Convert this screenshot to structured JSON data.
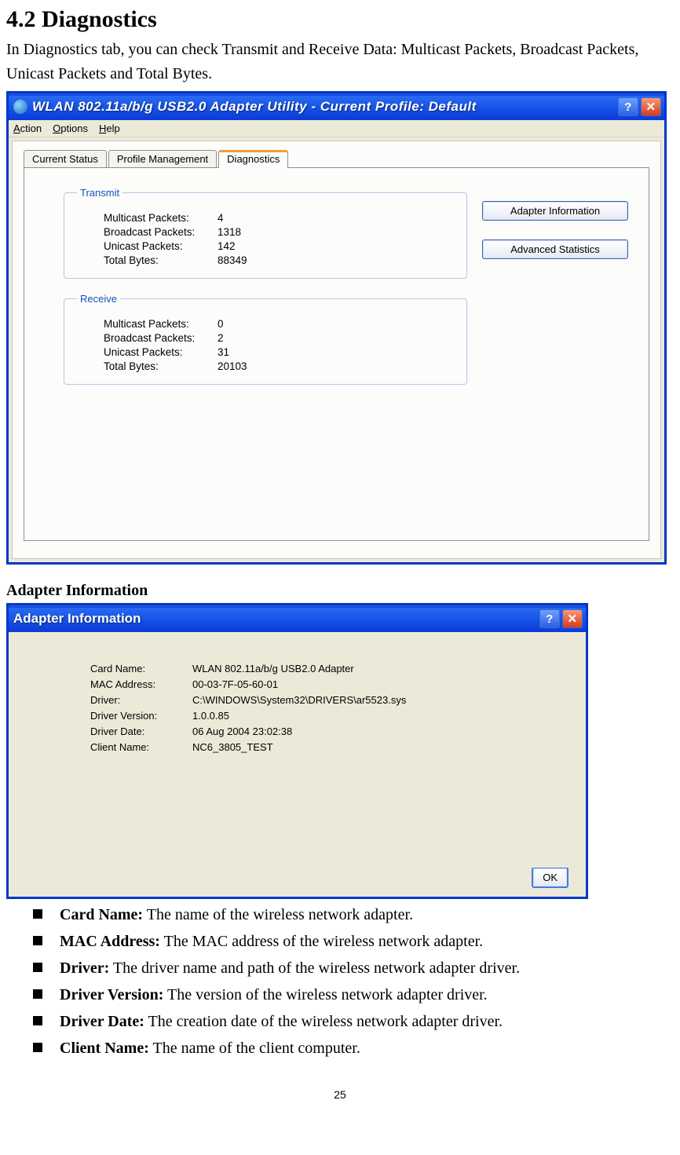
{
  "section": {
    "heading": "4.2 Diagnostics",
    "intro": "In Diagnostics tab, you can check Transmit and Receive Data: Multicast Packets, Broadcast Packets, Unicast Packets and Total Bytes."
  },
  "window1": {
    "title": "WLAN 802.11a/b/g USB2.0 Adapter Utility - Current Profile: Default",
    "menus": {
      "action": "Action",
      "options": "Options",
      "help": "Help"
    },
    "tabs": {
      "status": "Current Status",
      "profile": "Profile Management",
      "diag": "Diagnostics"
    },
    "transmit": {
      "legend": "Transmit",
      "multicast_label": "Multicast Packets:",
      "multicast_value": "4",
      "broadcast_label": "Broadcast Packets:",
      "broadcast_value": "1318",
      "unicast_label": "Unicast Packets:",
      "unicast_value": "142",
      "total_label": "Total Bytes:",
      "total_value": "88349"
    },
    "receive": {
      "legend": "Receive",
      "multicast_label": "Multicast Packets:",
      "multicast_value": "0",
      "broadcast_label": "Broadcast Packets:",
      "broadcast_value": "2",
      "unicast_label": "Unicast Packets:",
      "unicast_value": "31",
      "total_label": "Total Bytes:",
      "total_value": "20103"
    },
    "buttons": {
      "adapter_info": "Adapter Information",
      "adv_stats": "Advanced Statistics"
    }
  },
  "subheading": "Adapter Information",
  "window2": {
    "title": "Adapter Information",
    "fields": {
      "card_label": "Card Name:",
      "card_value": "WLAN 802.11a/b/g USB2.0 Adapter",
      "mac_label": "MAC Address:",
      "mac_value": "00-03-7F-05-60-01",
      "driver_label": "Driver:",
      "driver_value": "C:\\WINDOWS\\System32\\DRIVERS\\ar5523.sys",
      "ver_label": "Driver Version:",
      "ver_value": "1.0.0.85",
      "date_label": "Driver Date:",
      "date_value": "06 Aug 2004 23:02:38",
      "client_label": "Client Name:",
      "client_value": "NC6_3805_TEST"
    },
    "ok": "OK"
  },
  "bullets": {
    "card_name_b": "Card Name:",
    "card_name_t": " The name of the wireless network adapter.",
    "mac_b": "MAC Address:",
    "mac_t": " The MAC address of the wireless network adapter.",
    "driver_b": "Driver:",
    "driver_t": " The driver name and path of the wireless network adapter driver.",
    "ver_b": "Driver Version:",
    "ver_t": " The version of the wireless network adapter driver.",
    "date_b": "Driver Date:",
    "date_t": " The creation date of the wireless network adapter driver.",
    "client_b": "Client Name:",
    "client_t": " The name of the client computer."
  },
  "page_number": "25"
}
